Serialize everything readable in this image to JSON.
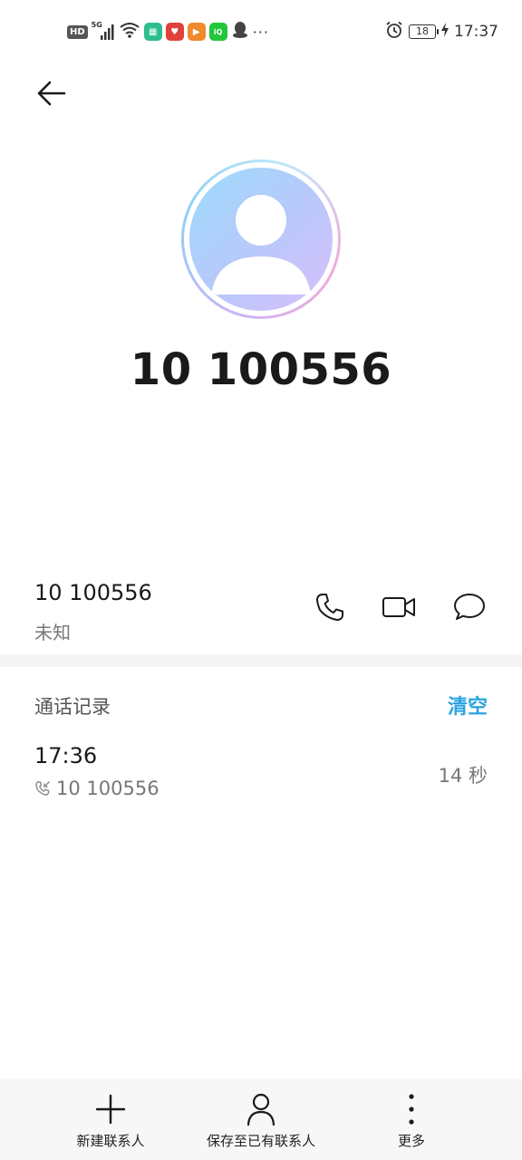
{
  "status_bar": {
    "network_badge": "HD",
    "network_type": "5G",
    "battery_level": "18",
    "time": "17:37"
  },
  "contact": {
    "title": "10 100556",
    "number": "10 100556",
    "number_label": "未知"
  },
  "call_log": {
    "header": "通话记录",
    "clear_label": "清空",
    "entries": [
      {
        "time": "17:36",
        "number": "10 100556",
        "duration": "14 秒"
      }
    ]
  },
  "bottom_bar": {
    "new_contact_label": "新建联系人",
    "save_existing_label": "保存至已有联系人",
    "more_label": "更多"
  },
  "colors": {
    "accent": "#2aa3e0",
    "text_primary": "#1a1a1a",
    "text_secondary": "#777777"
  }
}
